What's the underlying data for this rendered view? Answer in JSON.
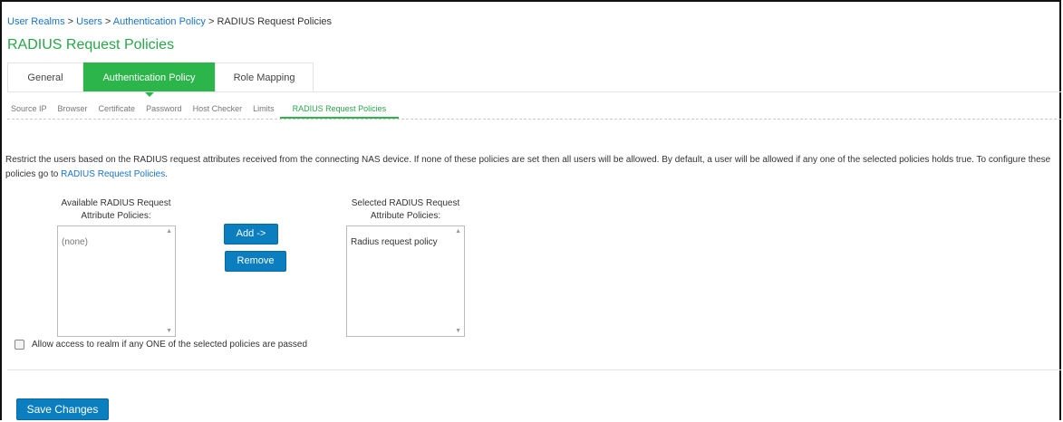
{
  "breadcrumb": {
    "items": [
      "User Realms",
      "Users",
      "Authentication Policy"
    ],
    "separator": " > ",
    "current": "RADIUS Request Policies"
  },
  "page_title": "RADIUS Request Policies",
  "tabs": [
    {
      "label": "General",
      "active": false
    },
    {
      "label": "Authentication Policy",
      "active": true
    },
    {
      "label": "Role Mapping",
      "active": false
    }
  ],
  "subtabs": [
    {
      "label": "Source IP",
      "active": false
    },
    {
      "label": "Browser",
      "active": false
    },
    {
      "label": "Certificate",
      "active": false
    },
    {
      "label": "Password",
      "active": false
    },
    {
      "label": "Host Checker",
      "active": false
    },
    {
      "label": "Limits",
      "active": false
    },
    {
      "label": "RADIUS Request Policies",
      "active": true
    }
  ],
  "description": {
    "text": "Restrict the users based on the RADIUS request attributes received from the connecting NAS device. If none of these policies are set then all users will be allowed. By default, a user will be allowed if any one of the selected policies holds true. To configure these policies go to ",
    "link": "RADIUS Request Policies",
    "suffix": "."
  },
  "available": {
    "label_line1": "Available RADIUS Request",
    "label_line2": "Attribute Policies:",
    "items": [
      "(none)"
    ]
  },
  "selected": {
    "label_line1": "Selected RADIUS Request",
    "label_line2": "Attribute Policies:",
    "items": [
      "Radius request policy"
    ]
  },
  "buttons": {
    "add": "Add ->",
    "remove": "Remove",
    "save": "Save Changes"
  },
  "checkbox": {
    "label": "Allow access to realm if any ONE of the selected policies are passed",
    "checked": false
  },
  "colors": {
    "accent_green": "#2bb54a",
    "link_blue": "#1a73c8",
    "button_blue": "#0a7ebf"
  }
}
